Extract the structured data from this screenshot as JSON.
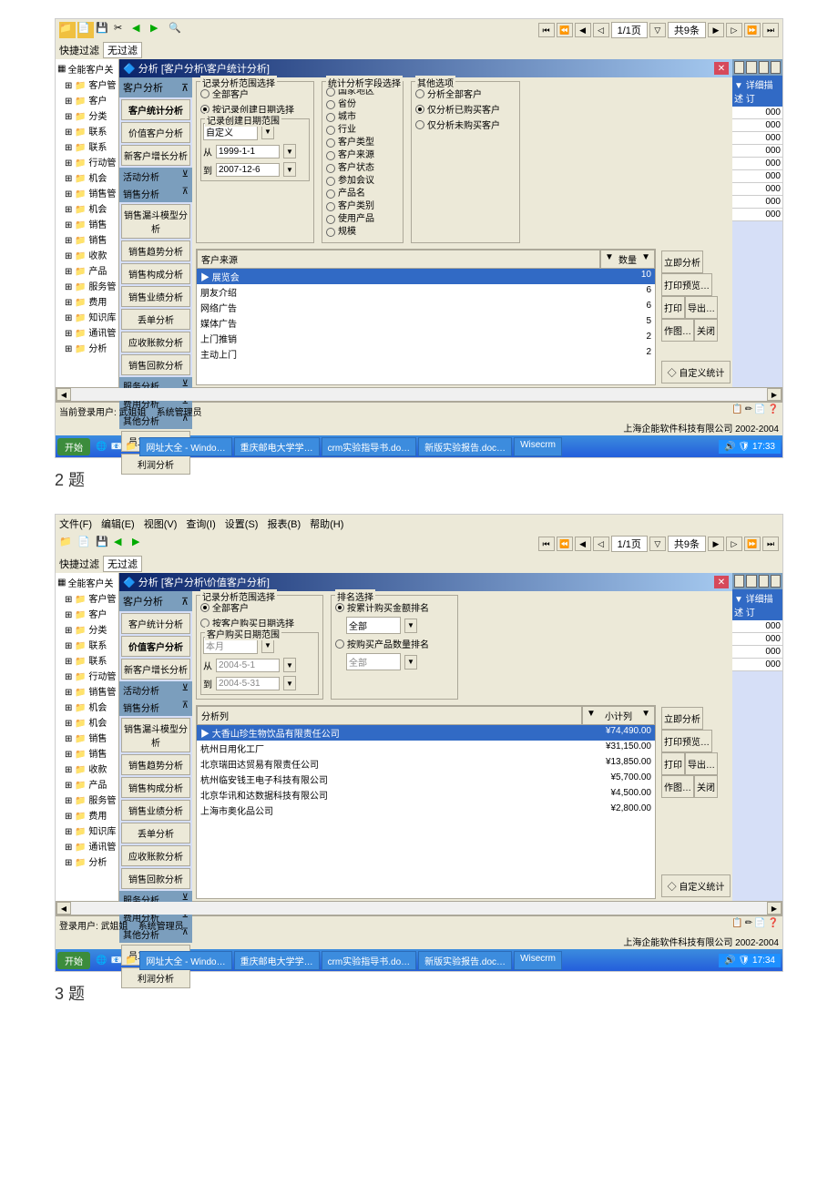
{
  "section1": {
    "dialog_title": "分析 [客户分析\\客户统计分析]",
    "filter_label": "快捷过滤",
    "filter_value": "无过滤",
    "page_info": "1/1页",
    "count_info": "共9条",
    "tree": {
      "root": "全能客户关",
      "items": [
        "客户管",
        "客户",
        "分类",
        "联系",
        "联系",
        "行动管",
        "机会",
        "销售管",
        "机会",
        "销售",
        "销售",
        "收款",
        "产品",
        "服务管",
        "费用",
        "知识库",
        "通讯管",
        "分析"
      ]
    },
    "sidebar": {
      "header": "客户分析",
      "items": [
        "客户统计分析",
        "价值客户分析",
        "新客户增长分析"
      ],
      "section2": "活动分析",
      "section3": "销售分析",
      "section3_items": [
        "销售漏斗模型分析",
        "销售趋势分析",
        "销售构成分析",
        "销售业绩分析",
        "丢单分析",
        "应收账款分析",
        "销售回款分析"
      ],
      "section4": "服务分析",
      "section5": "费用分析",
      "section6": "其他分析",
      "section6_items": [
        "员工业绩分析",
        "利润分析"
      ]
    },
    "options": {
      "range_title": "记录分析范围选择",
      "range_all": "全部客户",
      "range_date": "按记录创建日期选择",
      "date_range_title": "记录创建日期范围",
      "date_type": "自定义",
      "from_label": "从",
      "from_date": "1999-1-1",
      "to_label": "到",
      "to_date": "2007-12-6",
      "stat_title": "统计分析字段选择",
      "stat_fields": [
        "国家地区",
        "省份",
        "城市",
        "行业",
        "客户类型",
        "客户来源",
        "客户状态",
        "参加会议",
        "产品名",
        "客户类别",
        "使用产品",
        "规模"
      ],
      "other_title": "其他选项",
      "other_all": "分析全部客户",
      "other_bought": "仅分析已购买客户",
      "other_notbought": "仅分析未购买客户"
    },
    "result": {
      "col1": "客户来源",
      "col2": "数量",
      "rows": [
        {
          "name": "展览会",
          "value": "10"
        },
        {
          "name": "朋友介绍",
          "value": "6"
        },
        {
          "name": "网络广告",
          "value": "6"
        },
        {
          "name": "媒体广告",
          "value": "5"
        },
        {
          "name": "上门推销",
          "value": "2"
        },
        {
          "name": "主动上门",
          "value": "2"
        }
      ]
    },
    "actions": [
      "立即分析",
      "打印预览…",
      "打印",
      "导出…",
      "作图…",
      "关闭"
    ],
    "custom_stat": "自定义统计",
    "detail_header": "详细描述",
    "detail_col": "订",
    "detail_values": [
      "000",
      "000",
      "000",
      "000",
      "000",
      "000",
      "000",
      "000",
      "000"
    ],
    "status_user_label": "当前登录用户:",
    "status_user": "武姐姐",
    "status_role": "系统管理员",
    "copyright": "上海企能软件科技有限公司 2002-2004",
    "taskbar": {
      "start": "开始",
      "items": [
        "网址大全 - Windo…",
        "重庆邮电大学学…",
        "crm实验指导书.do…",
        "新版实验报告.doc…",
        "Wisecrm"
      ],
      "time": "17:33"
    }
  },
  "label2": "2 题",
  "section2": {
    "menu": [
      "文件(F)",
      "编辑(E)",
      "视图(V)",
      "查询(I)",
      "设置(S)",
      "报表(B)",
      "帮助(H)"
    ],
    "dialog_title": "分析 [客户分析\\价值客户分析]",
    "filter_label": "快捷过滤",
    "filter_value": "无过滤",
    "page_info": "1/1页",
    "count_info": "共9条",
    "tree": {
      "root": "全能客户关",
      "items": [
        "客户管",
        "客户",
        "分类",
        "联系",
        "联系",
        "行动管",
        "销售管",
        "机会",
        "机会",
        "销售",
        "销售",
        "收款",
        "产品",
        "服务管",
        "费用",
        "知识库",
        "通讯管",
        "分析"
      ]
    },
    "sidebar": {
      "header": "客户分析",
      "items": [
        "客户统计分析",
        "价值客户分析",
        "新客户增长分析"
      ],
      "section2": "活动分析",
      "section3": "销售分析",
      "section3_items": [
        "销售漏斗模型分析",
        "销售趋势分析",
        "销售构成分析",
        "销售业绩分析",
        "丢单分析",
        "应收账款分析",
        "销售回款分析"
      ],
      "section4": "服务分析",
      "section5": "费用分析",
      "section6": "其他分析",
      "section6_items": [
        "员工业绩分析",
        "利润分析"
      ]
    },
    "options": {
      "range_title": "记录分析范围选择",
      "range_all": "全部客户",
      "range_date": "按客户购买日期选择",
      "date_range_title": "客户购买日期范围",
      "date_type": "本月",
      "from_label": "从",
      "from_date": "2004-5-1",
      "to_label": "到",
      "to_date": "2004-5-31",
      "rank_title": "排名选择",
      "rank_amount": "按累计购买金额排名",
      "rank_amount_val": "全部",
      "rank_qty": "按购买产品数量排名",
      "rank_qty_val": "全部"
    },
    "result": {
      "col1": "分析列",
      "col2": "小计列",
      "rows": [
        {
          "name": "大香山珍生物饮品有限责任公司",
          "value": "¥74,490.00"
        },
        {
          "name": "杭州日用化工厂",
          "value": "¥31,150.00"
        },
        {
          "name": "北京瑞田达贸易有限责任公司",
          "value": "¥13,850.00"
        },
        {
          "name": "杭州临安钱王电子科技有限公司",
          "value": "¥5,700.00"
        },
        {
          "name": "北京华讯和达数据科技有限公司",
          "value": "¥4,500.00"
        },
        {
          "name": "上海市奥化品公司",
          "value": "¥2,800.00"
        }
      ]
    },
    "actions": [
      "立即分析",
      "打印预览…",
      "打印",
      "导出…",
      "作图…",
      "关闭"
    ],
    "custom_stat": "自定义统计",
    "status_user_label": "登录用户:",
    "status_user": "武姐姐",
    "status_role": "系统管理员",
    "copyright": "上海企能软件科技有限公司 2002-2004",
    "taskbar": {
      "start": "开始",
      "items": [
        "网址大全 - Windo…",
        "重庆邮电大学学…",
        "crm实验指导书.do…",
        "新版实验报告.doc…",
        "Wisecrm"
      ],
      "time": "17:34"
    }
  },
  "label3": "3 题"
}
